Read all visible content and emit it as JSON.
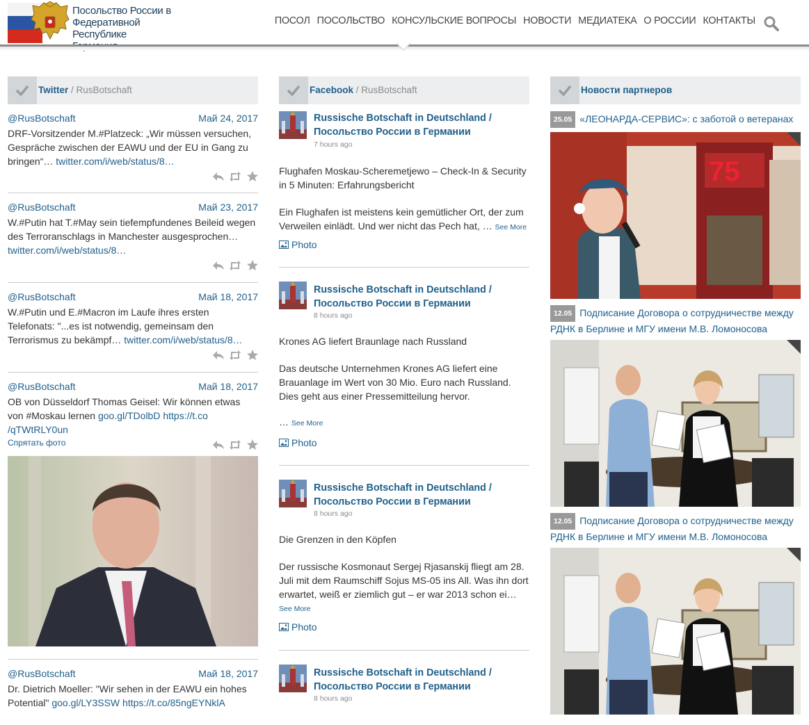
{
  "header": {
    "title_lines": [
      "Посольство России в",
      "Федеративной Республике",
      "Германия"
    ],
    "nav": [
      "ПОСОЛ",
      "ПОСОЛЬСТВО",
      "КОНСУЛЬСКИЕ ВОПРОСЫ",
      "НОВОСТИ",
      "МЕДИАТЕКА",
      "О РОССИИ",
      "КОНТАКТЫ"
    ],
    "search_icon": "magnifier-icon",
    "flag_colors": [
      "#ffffff",
      "#2a54a4",
      "#d52b1e"
    ]
  },
  "twitter": {
    "head_label": "Twitter",
    "head_sub": " / RusBotschaft",
    "tweets": [
      {
        "user": "@RusBotschaft",
        "date": "Май 24, 2017",
        "text": "DRF-Vorsitzender M.#Platzeck: „Wir müssen versuchen, Gespräche zwischen der EAWU und der EU in Gang zu bringen“…",
        "link": "twitter.com/i/web/status/8…"
      },
      {
        "user": "@RusBotschaft",
        "date": "Май 23, 2017",
        "text": "W.#Putin hat T.#May sein tiefempfundenes Beileid wegen des Terroranschlags in Manchester ausgesprochen…",
        "link": "twitter.com/i/web/status/8…"
      },
      {
        "user": "@RusBotschaft",
        "date": "Май 18, 2017",
        "text": "W.#Putin und E.#Macron im Laufe ihres ersten Telefonats: \"...es ist notwendig, gemeinsam den Terrorismus zu bekämpf…",
        "link": "twitter.com/i/web/status/8…"
      },
      {
        "user": "@RusBotschaft",
        "date": "Май 18, 2017",
        "text": "OB von Düsseldorf Thomas Geisel: Wir können etwas von #Moskau lernen",
        "link": "goo.gl/TDolbD https://t.co /qTWtRLY0un",
        "hide_photo": "Спрятать фото"
      },
      {
        "user": "@RusBotschaft",
        "date": "Май 18, 2017",
        "text": "Dr. Dietrich Moeller: \"Wir sehen in der EAWU ein hohes Potential\"",
        "link": "goo.gl/LY3SSW https://t.co/85ngEYNklA"
      }
    ],
    "action_icons": [
      "reply-icon",
      "retweet-icon",
      "favorite-star-icon"
    ]
  },
  "facebook": {
    "head_label": "Facebook",
    "head_sub": " / RusBotschaft",
    "photo_label": "Photo",
    "see_more": "See More",
    "posts": [
      {
        "author": "Russische Botschaft in Deutschland / Посольство России в Германии",
        "time": "7 hours ago",
        "p1": "Flughafen Moskau-Scheremetjewo – Check-In & Security in 5 Minuten: Erfahrungsbericht",
        "p2": "Ein Flughafen ist meistens kein gemütlicher Ort, der zum Verweilen einlädt. Und wer nicht das Pech hat, …"
      },
      {
        "author": "Russische Botschaft in Deutschland / Посольство России в Германии",
        "time": "8 hours ago",
        "p1": "Krones AG liefert Braunlage nach Russland",
        "p2": "Das deutsche Unternehmen Krones AG liefert eine Brauanlage im Wert von 30 Mio. Euro nach Russland. Dies geht aus einer Pressemitteilung hervor.",
        "p3": "…"
      },
      {
        "author": "Russische Botschaft in Deutschland / Посольство России в Германии",
        "time": "8 hours ago",
        "p1": "Die Grenzen in den Köpfen",
        "p2": "Der russische Kosmonaut Sergej Rjasanskij fliegt am 28. Juli mit dem Raumschiff Sojus MS-05 ins All. Was ihn dort erwartet, weiß er ziemlich gut – er war 2013 schon ei…"
      },
      {
        "author": "Russische Botschaft in Deutschland / Посольство России в Германии",
        "time": "8 hours ago"
      }
    ]
  },
  "partners": {
    "head_label": "Новости партнеров",
    "items": [
      {
        "date": "25.05",
        "title": "«ЛЕОНАРДА-СЕРВИС»: с заботой о ветеранах"
      },
      {
        "date": "12.05",
        "title": "Подписание Договора о сотрудничестве между РДНК в Берлине и МГУ имени М.В. Ломоносова"
      },
      {
        "date": "12.05",
        "title": "Подписание Договора о сотрудничестве между РДНК в Берлине и МГУ имени М.В. Ломоносова"
      }
    ]
  }
}
